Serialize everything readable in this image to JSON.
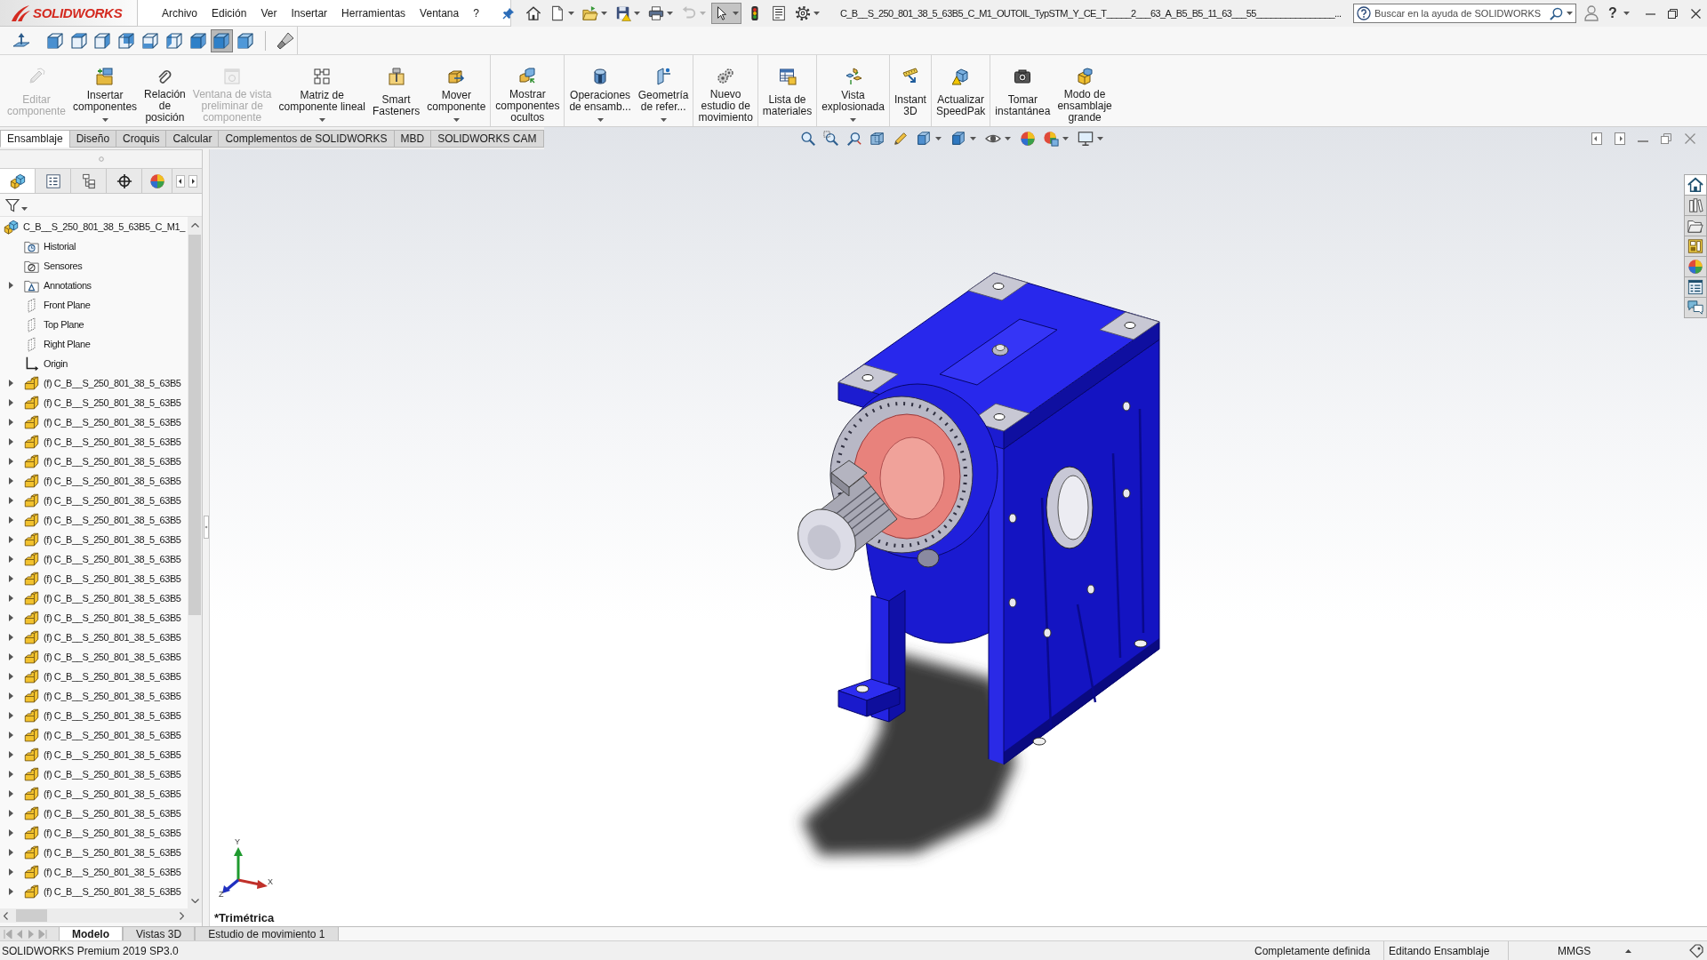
{
  "app": {
    "logo": "SOLIDWORKS",
    "menu": [
      "Archivo",
      "Edición",
      "Ver",
      "Insertar",
      "Herramientas",
      "Ventana",
      "?"
    ],
    "quick_access": [
      {
        "selected": false,
        "disabled": false
      },
      {
        "selected": false,
        "disabled": false
      },
      {
        "selected": false,
        "disabled": false
      },
      {
        "selected": false,
        "disabled": false
      },
      {
        "selected": false,
        "disabled": false
      },
      {
        "selected": false,
        "disabled": true
      },
      {
        "selected": true,
        "disabled": false
      },
      {
        "selected": false,
        "disabled": false
      },
      {
        "selected": false,
        "disabled": false
      },
      {
        "selected": false,
        "disabled": false
      }
    ],
    "title": "C_B__S_250_801_38_5_63B5_C_M1_OUTOIL_TypSTM_Y_CE_T_____2___63_A_B5_B5_11_63___55________________...",
    "search": {
      "placeholder": "Buscar en la ayuda de SOLIDWORKS"
    },
    "help_label": "?"
  },
  "view_toolbar": [
    {
      "selected": false
    },
    {
      "selected": false
    },
    {
      "selected": false
    },
    {
      "selected": false
    },
    {
      "selected": false
    },
    {
      "selected": false
    },
    {
      "selected": false
    },
    {
      "selected": false
    },
    {
      "selected": true
    },
    {
      "selected": false
    },
    {
      "selected": false
    }
  ],
  "ribbon": {
    "groups": [
      [
        {
          "label": "Editar\ncomponente",
          "disabled": true,
          "menu": false
        },
        {
          "label": "Insertar\ncomponentes",
          "disabled": false,
          "menu": true
        },
        {
          "label": "Relación\nde\nposición",
          "disabled": false,
          "menu": false
        },
        {
          "label": "Ventana de vista\npreliminar de\ncomponente",
          "disabled": true,
          "menu": false
        },
        {
          "label": "Matriz de\ncomponente lineal",
          "disabled": false,
          "menu": true
        },
        {
          "label": "Smart\nFasteners",
          "disabled": false,
          "menu": false
        },
        {
          "label": "Mover\ncomponente",
          "disabled": false,
          "menu": true
        }
      ],
      [
        {
          "label": "Mostrar\ncomponentes\nocultos",
          "disabled": false,
          "menu": false
        }
      ],
      [
        {
          "label": "Operaciones\nde ensamb...",
          "disabled": false,
          "menu": true
        },
        {
          "label": "Geometría\nde refer...",
          "disabled": false,
          "menu": true
        }
      ],
      [
        {
          "label": "Nuevo\nestudio de\nmovimiento",
          "disabled": false,
          "menu": false
        }
      ],
      [
        {
          "label": "Lista de\nmateriales",
          "disabled": false,
          "menu": false
        }
      ],
      [
        {
          "label": "Vista\nexplosionada",
          "disabled": false,
          "menu": true
        }
      ],
      [
        {
          "label": "Instant\n3D",
          "disabled": false,
          "menu": false
        }
      ],
      [
        {
          "label": "Actualizar\nSpeedPak",
          "disabled": false,
          "menu": false
        }
      ],
      [
        {
          "label": "Tomar\ninstantánea",
          "disabled": false,
          "menu": false
        },
        {
          "label": "Modo de\nensamblaje\ngrande",
          "disabled": false,
          "menu": false
        }
      ]
    ]
  },
  "command_tabs": [
    {
      "label": "Ensamblaje",
      "selected": true
    },
    {
      "label": "Diseño",
      "selected": false
    },
    {
      "label": "Croquis",
      "selected": false
    },
    {
      "label": "Calcular",
      "selected": false
    },
    {
      "label": "Complementos de SOLIDWORKS",
      "selected": false
    },
    {
      "label": "MBD",
      "selected": false
    },
    {
      "label": "SOLIDWORKS CAM",
      "selected": false
    }
  ],
  "feature_manager": {
    "tabs": [
      {
        "selected": true
      },
      {
        "selected": false
      },
      {
        "selected": false
      },
      {
        "selected": false
      },
      {
        "selected": false
      }
    ],
    "tree": {
      "label": "C_B__S_250_801_38_5_63B5_C_M1_",
      "kind": "assembly",
      "children": [
        {
          "label": "Historial",
          "kind": "history"
        },
        {
          "label": "Sensores",
          "kind": "sensors"
        },
        {
          "label": "Annotations",
          "kind": "annotations",
          "expanded": false
        },
        {
          "label": "Front Plane",
          "kind": "plane"
        },
        {
          "label": "Top Plane",
          "kind": "plane"
        },
        {
          "label": "Right Plane",
          "kind": "plane"
        },
        {
          "label": "Origin",
          "kind": "origin"
        },
        {
          "label": "(f) C_B__S_250_801_38_5_63B5",
          "kind": "part",
          "expanded": false
        },
        {
          "label": "(f) C_B__S_250_801_38_5_63B5",
          "kind": "part",
          "expanded": false
        },
        {
          "label": "(f) C_B__S_250_801_38_5_63B5",
          "kind": "part",
          "expanded": false
        },
        {
          "label": "(f) C_B__S_250_801_38_5_63B5",
          "kind": "part",
          "expanded": false
        },
        {
          "label": "(f) C_B__S_250_801_38_5_63B5",
          "kind": "part",
          "expanded": false
        },
        {
          "label": "(f) C_B__S_250_801_38_5_63B5",
          "kind": "part",
          "expanded": false
        },
        {
          "label": "(f) C_B__S_250_801_38_5_63B5",
          "kind": "part",
          "expanded": false
        },
        {
          "label": "(f) C_B__S_250_801_38_5_63B5",
          "kind": "part",
          "expanded": false
        },
        {
          "label": "(f) C_B__S_250_801_38_5_63B5",
          "kind": "part",
          "expanded": false
        },
        {
          "label": "(f) C_B__S_250_801_38_5_63B5",
          "kind": "part",
          "expanded": false
        },
        {
          "label": "(f) C_B__S_250_801_38_5_63B5",
          "kind": "part",
          "expanded": false
        },
        {
          "label": "(f) C_B__S_250_801_38_5_63B5",
          "kind": "part",
          "expanded": false
        },
        {
          "label": "(f) C_B__S_250_801_38_5_63B5",
          "kind": "part",
          "expanded": false
        },
        {
          "label": "(f) C_B__S_250_801_38_5_63B5",
          "kind": "part",
          "expanded": false
        },
        {
          "label": "(f) C_B__S_250_801_38_5_63B5",
          "kind": "part",
          "expanded": false
        },
        {
          "label": "(f) C_B__S_250_801_38_5_63B5",
          "kind": "part",
          "expanded": false
        },
        {
          "label": "(f) C_B__S_250_801_38_5_63B5",
          "kind": "part",
          "expanded": false
        },
        {
          "label": "(f) C_B__S_250_801_38_5_63B5",
          "kind": "part",
          "expanded": false
        },
        {
          "label": "(f) C_B__S_250_801_38_5_63B5",
          "kind": "part",
          "expanded": false
        },
        {
          "label": "(f) C_B__S_250_801_38_5_63B5",
          "kind": "part",
          "expanded": false
        },
        {
          "label": "(f) C_B__S_250_801_38_5_63B5",
          "kind": "part",
          "expanded": false
        },
        {
          "label": "(f) C_B__S_250_801_38_5_63B5",
          "kind": "part",
          "expanded": false
        },
        {
          "label": "(f) C_B__S_250_801_38_5_63B5",
          "kind": "part",
          "expanded": false
        },
        {
          "label": "(f) C_B__S_250_801_38_5_63B5",
          "kind": "part",
          "expanded": false
        },
        {
          "label": "(f) C_B__S_250_801_38_5_63B5",
          "kind": "part",
          "expanded": false
        },
        {
          "label": "(f) C_B__S_250_801_38_5_63B5",
          "kind": "part",
          "expanded": false
        },
        {
          "label": "(f) C_B__S_250_801_38_5_63B5",
          "kind": "part",
          "expanded": false
        }
      ]
    }
  },
  "viewport": {
    "view_name": "*Trimétrica",
    "triad_labels": [
      "X",
      "Y",
      "Z"
    ],
    "task_pane": [
      {
        "selected": true
      },
      {
        "selected": false
      },
      {
        "selected": false
      },
      {
        "selected": false
      },
      {
        "selected": false
      },
      {
        "selected": false
      },
      {
        "selected": false
      }
    ]
  },
  "bottom_tabs": [
    {
      "label": "Modelo",
      "selected": true
    },
    {
      "label": "Vistas 3D",
      "selected": false
    },
    {
      "label": "Estudio de movimiento 1",
      "selected": false
    }
  ],
  "status_bar": {
    "product": "SOLIDWORKS Premium 2019 SP3.0",
    "fields": [
      "Completamente definida",
      "Editando Ensamblaje",
      "MMGS"
    ]
  }
}
